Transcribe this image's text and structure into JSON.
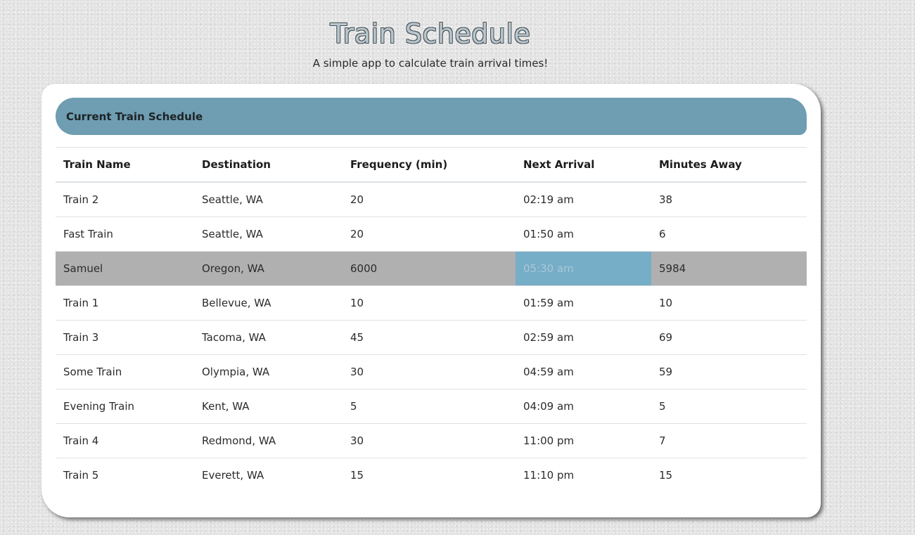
{
  "header": {
    "title": "Train Schedule",
    "subtitle": "A simple app to calculate train arrival times!"
  },
  "card": {
    "title": "Current Train Schedule"
  },
  "table": {
    "columns": [
      "Train Name",
      "Destination",
      "Frequency (min)",
      "Next Arrival",
      "Minutes Away"
    ],
    "rows": [
      [
        "Train 2",
        "Seattle, WA",
        "20",
        "02:19 am",
        "38"
      ],
      [
        "Fast Train",
        "Seattle, WA",
        "20",
        "01:50 am",
        "6"
      ],
      [
        "Samuel",
        "Oregon, WA",
        "6000",
        "05:30 am",
        "5984"
      ],
      [
        "Train 1",
        "Bellevue, WA",
        "10",
        "01:59 am",
        "10"
      ],
      [
        "Train 3",
        "Tacoma, WA",
        "45",
        "02:59 am",
        "69"
      ],
      [
        "Some Train",
        "Olympia, WA",
        "30",
        "04:59 am",
        "59"
      ],
      [
        "Evening Train",
        "Kent, WA",
        "5",
        "04:09 am",
        "5"
      ],
      [
        "Train 4",
        "Redmond, WA",
        "30",
        "11:00 pm",
        "7"
      ],
      [
        "Train 5",
        "Everett, WA",
        "15",
        "11:10 pm",
        "15"
      ]
    ]
  },
  "colors": {
    "header_bar": "#6f9db2",
    "selected_row": "#b0b0b0",
    "highlighted_cell": "#76adc7"
  }
}
